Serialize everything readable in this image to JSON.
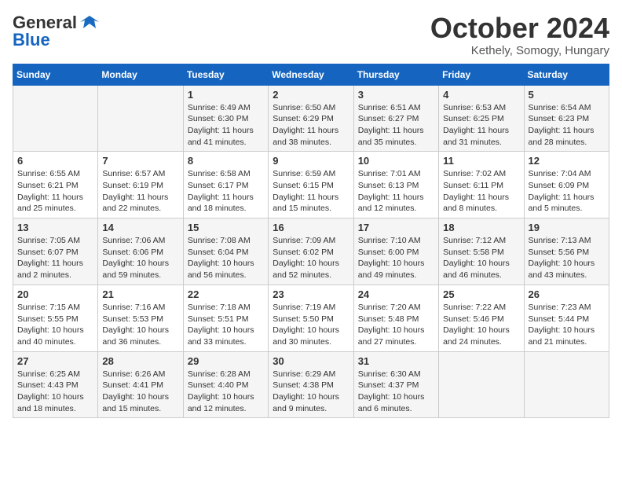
{
  "logo": {
    "line1": "General",
    "line2": "Blue"
  },
  "header": {
    "month": "October 2024",
    "location": "Kethely, Somogy, Hungary"
  },
  "weekdays": [
    "Sunday",
    "Monday",
    "Tuesday",
    "Wednesday",
    "Thursday",
    "Friday",
    "Saturday"
  ],
  "weeks": [
    [
      {
        "day": "",
        "info": ""
      },
      {
        "day": "",
        "info": ""
      },
      {
        "day": "1",
        "info": "Sunrise: 6:49 AM\nSunset: 6:30 PM\nDaylight: 11 hours and 41 minutes."
      },
      {
        "day": "2",
        "info": "Sunrise: 6:50 AM\nSunset: 6:29 PM\nDaylight: 11 hours and 38 minutes."
      },
      {
        "day": "3",
        "info": "Sunrise: 6:51 AM\nSunset: 6:27 PM\nDaylight: 11 hours and 35 minutes."
      },
      {
        "day": "4",
        "info": "Sunrise: 6:53 AM\nSunset: 6:25 PM\nDaylight: 11 hours and 31 minutes."
      },
      {
        "day": "5",
        "info": "Sunrise: 6:54 AM\nSunset: 6:23 PM\nDaylight: 11 hours and 28 minutes."
      }
    ],
    [
      {
        "day": "6",
        "info": "Sunrise: 6:55 AM\nSunset: 6:21 PM\nDaylight: 11 hours and 25 minutes."
      },
      {
        "day": "7",
        "info": "Sunrise: 6:57 AM\nSunset: 6:19 PM\nDaylight: 11 hours and 22 minutes."
      },
      {
        "day": "8",
        "info": "Sunrise: 6:58 AM\nSunset: 6:17 PM\nDaylight: 11 hours and 18 minutes."
      },
      {
        "day": "9",
        "info": "Sunrise: 6:59 AM\nSunset: 6:15 PM\nDaylight: 11 hours and 15 minutes."
      },
      {
        "day": "10",
        "info": "Sunrise: 7:01 AM\nSunset: 6:13 PM\nDaylight: 11 hours and 12 minutes."
      },
      {
        "day": "11",
        "info": "Sunrise: 7:02 AM\nSunset: 6:11 PM\nDaylight: 11 hours and 8 minutes."
      },
      {
        "day": "12",
        "info": "Sunrise: 7:04 AM\nSunset: 6:09 PM\nDaylight: 11 hours and 5 minutes."
      }
    ],
    [
      {
        "day": "13",
        "info": "Sunrise: 7:05 AM\nSunset: 6:07 PM\nDaylight: 11 hours and 2 minutes."
      },
      {
        "day": "14",
        "info": "Sunrise: 7:06 AM\nSunset: 6:06 PM\nDaylight: 10 hours and 59 minutes."
      },
      {
        "day": "15",
        "info": "Sunrise: 7:08 AM\nSunset: 6:04 PM\nDaylight: 10 hours and 56 minutes."
      },
      {
        "day": "16",
        "info": "Sunrise: 7:09 AM\nSunset: 6:02 PM\nDaylight: 10 hours and 52 minutes."
      },
      {
        "day": "17",
        "info": "Sunrise: 7:10 AM\nSunset: 6:00 PM\nDaylight: 10 hours and 49 minutes."
      },
      {
        "day": "18",
        "info": "Sunrise: 7:12 AM\nSunset: 5:58 PM\nDaylight: 10 hours and 46 minutes."
      },
      {
        "day": "19",
        "info": "Sunrise: 7:13 AM\nSunset: 5:56 PM\nDaylight: 10 hours and 43 minutes."
      }
    ],
    [
      {
        "day": "20",
        "info": "Sunrise: 7:15 AM\nSunset: 5:55 PM\nDaylight: 10 hours and 40 minutes."
      },
      {
        "day": "21",
        "info": "Sunrise: 7:16 AM\nSunset: 5:53 PM\nDaylight: 10 hours and 36 minutes."
      },
      {
        "day": "22",
        "info": "Sunrise: 7:18 AM\nSunset: 5:51 PM\nDaylight: 10 hours and 33 minutes."
      },
      {
        "day": "23",
        "info": "Sunrise: 7:19 AM\nSunset: 5:50 PM\nDaylight: 10 hours and 30 minutes."
      },
      {
        "day": "24",
        "info": "Sunrise: 7:20 AM\nSunset: 5:48 PM\nDaylight: 10 hours and 27 minutes."
      },
      {
        "day": "25",
        "info": "Sunrise: 7:22 AM\nSunset: 5:46 PM\nDaylight: 10 hours and 24 minutes."
      },
      {
        "day": "26",
        "info": "Sunrise: 7:23 AM\nSunset: 5:44 PM\nDaylight: 10 hours and 21 minutes."
      }
    ],
    [
      {
        "day": "27",
        "info": "Sunrise: 6:25 AM\nSunset: 4:43 PM\nDaylight: 10 hours and 18 minutes."
      },
      {
        "day": "28",
        "info": "Sunrise: 6:26 AM\nSunset: 4:41 PM\nDaylight: 10 hours and 15 minutes."
      },
      {
        "day": "29",
        "info": "Sunrise: 6:28 AM\nSunset: 4:40 PM\nDaylight: 10 hours and 12 minutes."
      },
      {
        "day": "30",
        "info": "Sunrise: 6:29 AM\nSunset: 4:38 PM\nDaylight: 10 hours and 9 minutes."
      },
      {
        "day": "31",
        "info": "Sunrise: 6:30 AM\nSunset: 4:37 PM\nDaylight: 10 hours and 6 minutes."
      },
      {
        "day": "",
        "info": ""
      },
      {
        "day": "",
        "info": ""
      }
    ]
  ]
}
